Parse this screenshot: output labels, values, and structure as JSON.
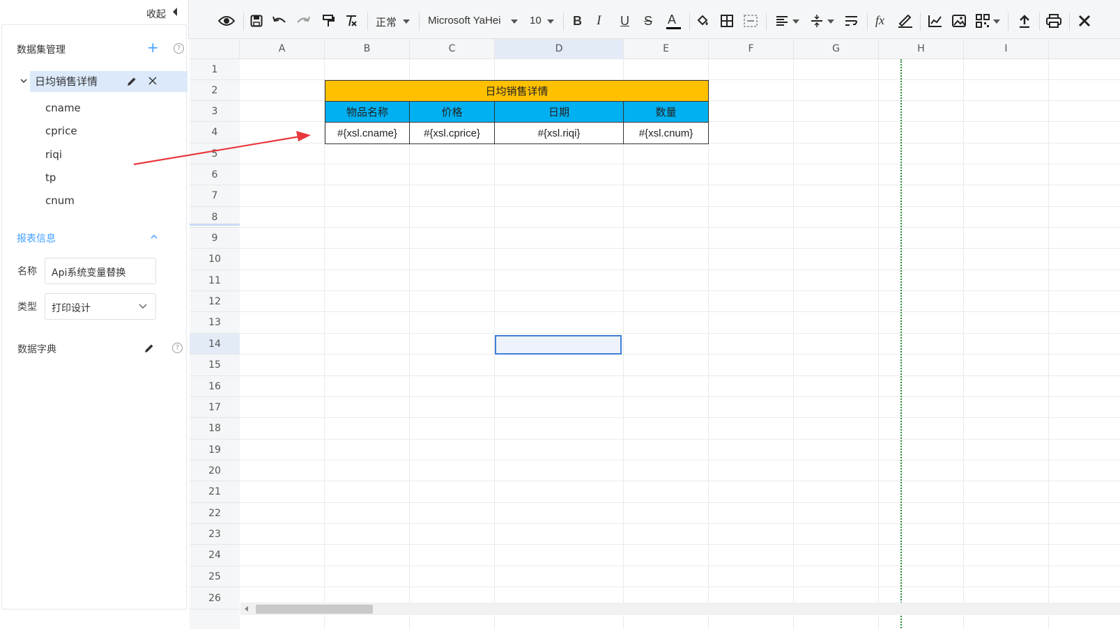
{
  "left_panel": {
    "collapse_label": "收起",
    "dataset_section_title": "数据集管理",
    "help_icon": "?",
    "add_icon": "+",
    "dataset_name": "日均销售详情",
    "fields": [
      "cname",
      "cprice",
      "riqi",
      "tp",
      "cnum"
    ],
    "report_info_title": "报表信息",
    "name_label": "名称",
    "name_value": "Api系统变量替换",
    "type_label": "类型",
    "type_value": "打印设计",
    "dict_label": "数据字典"
  },
  "toolbar": {
    "style_select": "正常",
    "font_select": "Microsoft YaHei",
    "size_select": "10",
    "bold": "B",
    "italic": "I",
    "underline": "U",
    "strike": "S",
    "font_color": "A",
    "formula": "fx",
    "font_color_bar": "#000000"
  },
  "grid": {
    "columns": [
      "A",
      "B",
      "C",
      "D",
      "E",
      "F",
      "G",
      "H",
      "I"
    ],
    "rows": [
      "1",
      "2",
      "3",
      "4",
      "5",
      "6",
      "7",
      "8",
      "9",
      "10",
      "11",
      "12",
      "13",
      "14",
      "15",
      "16",
      "17",
      "18",
      "19",
      "20",
      "21",
      "22",
      "23",
      "24",
      "25",
      "26"
    ],
    "selected_column": "D",
    "selected_row": "14",
    "title_cell": "日均销售详情",
    "header_cells": [
      "物品名称",
      "价格",
      "日期",
      "数量"
    ],
    "data_cells": [
      "#{xsl.cname}",
      "#{xsl.cprice}",
      "#{xsl.riqi}",
      "#{xsl.cnum}"
    ],
    "title_color": "#ffc000",
    "header_color": "#00b0f0",
    "page_break_color": "#1f8b3a"
  },
  "annotation": {
    "arrow_color": "#e8383d"
  }
}
